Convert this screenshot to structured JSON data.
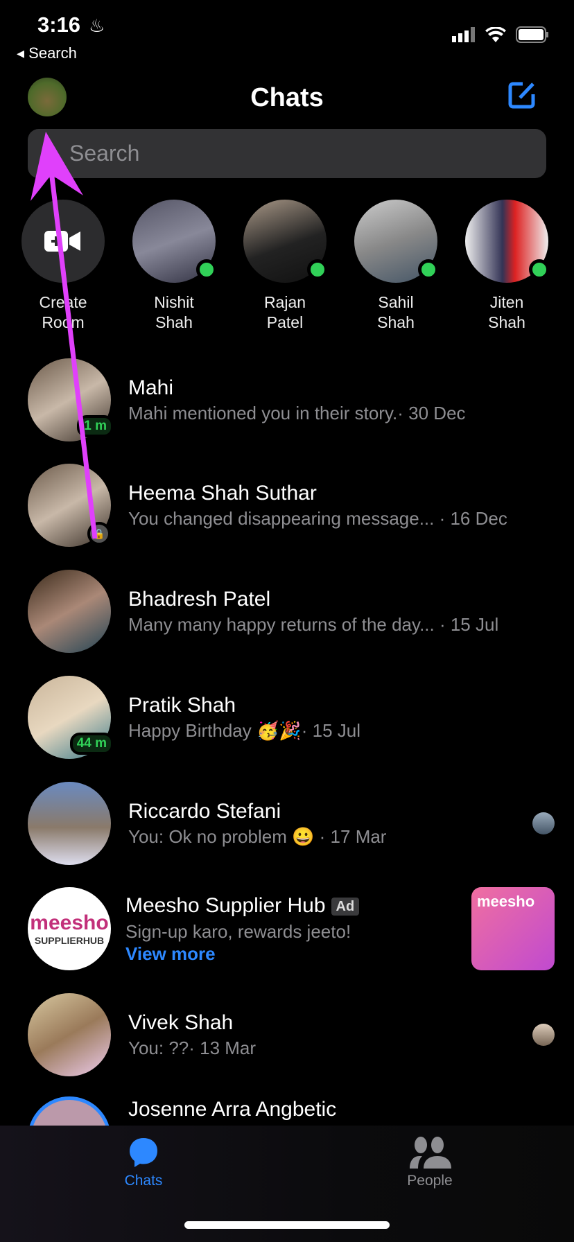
{
  "status": {
    "time": "3:16",
    "back_label": "Search"
  },
  "header": {
    "title": "Chats"
  },
  "search": {
    "placeholder": "Search"
  },
  "stories": [
    {
      "name_line1": "Create",
      "name_line2": "Room",
      "online": false
    },
    {
      "name_line1": "Nishit",
      "name_line2": "Shah",
      "online": true
    },
    {
      "name_line1": "Rajan",
      "name_line2": "Patel",
      "online": true
    },
    {
      "name_line1": "Sahil",
      "name_line2": "Shah",
      "online": true
    },
    {
      "name_line1": "Jiten",
      "name_line2": "Shah",
      "online": true
    }
  ],
  "chats": [
    {
      "name": "Mahi",
      "preview": "Mahi mentioned you in their story.· 30 Dec",
      "badge": "1 m"
    },
    {
      "name": "Heema Shah Suthar",
      "preview": "You changed disappearing message... · 16 Dec"
    },
    {
      "name": "Bhadresh Patel",
      "preview": "Many many happy returns of the day... · 15 Jul"
    },
    {
      "name": "Pratik Shah",
      "preview": "Happy Birthday 🥳🎉· 15 Jul",
      "badge": "44 m"
    },
    {
      "name": "Riccardo Stefani",
      "preview": "You: Ok no problem 😀 · 17 Mar"
    },
    {
      "name": "Meesho Supplier Hub",
      "ad_label": "Ad",
      "preview": "Sign-up karo, rewards jeeto!",
      "link": "View more",
      "logo_text1": "meesho",
      "logo_text2": "SUPPLIERHUB",
      "thumb_text": "meesho"
    },
    {
      "name": "Vivek Shah",
      "preview": "You: ??· 13 Mar"
    },
    {
      "name": "Josenne Arra Angbetic"
    }
  ],
  "tabs": [
    {
      "label": "Chats",
      "active": true
    },
    {
      "label": "People",
      "active": false
    }
  ],
  "colors": {
    "accent": "#2d88ff",
    "online": "#31d158",
    "annotation_arrow": "#e040fb"
  }
}
